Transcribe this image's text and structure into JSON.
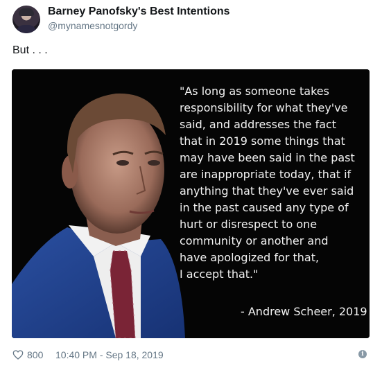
{
  "author": {
    "display_name": "Barney Panofsky's Best Intentions",
    "handle": "@mynamesnotgordy",
    "avatar_icon": "user-avatar"
  },
  "tweet": {
    "text": "But . . ."
  },
  "media": {
    "quote_lines": [
      "\"As long as someone takes",
      "responsibility for what they've",
      "said, and addresses the fact",
      "that in 2019 some things that",
      "may have been said in the past",
      "are inappropriate today, that if",
      "anything that they've ever said",
      "in the past caused any type of",
      "hurt or disrespect to one",
      "community or another and",
      "have apologized for that,",
      "I accept that.\""
    ],
    "attribution": "- Andrew Scheer, 2019"
  },
  "footer": {
    "like_icon": "heart-outline",
    "like_count": "800",
    "timestamp": "10:40 PM - Sep 18, 2019",
    "info_icon": "info-circle"
  }
}
